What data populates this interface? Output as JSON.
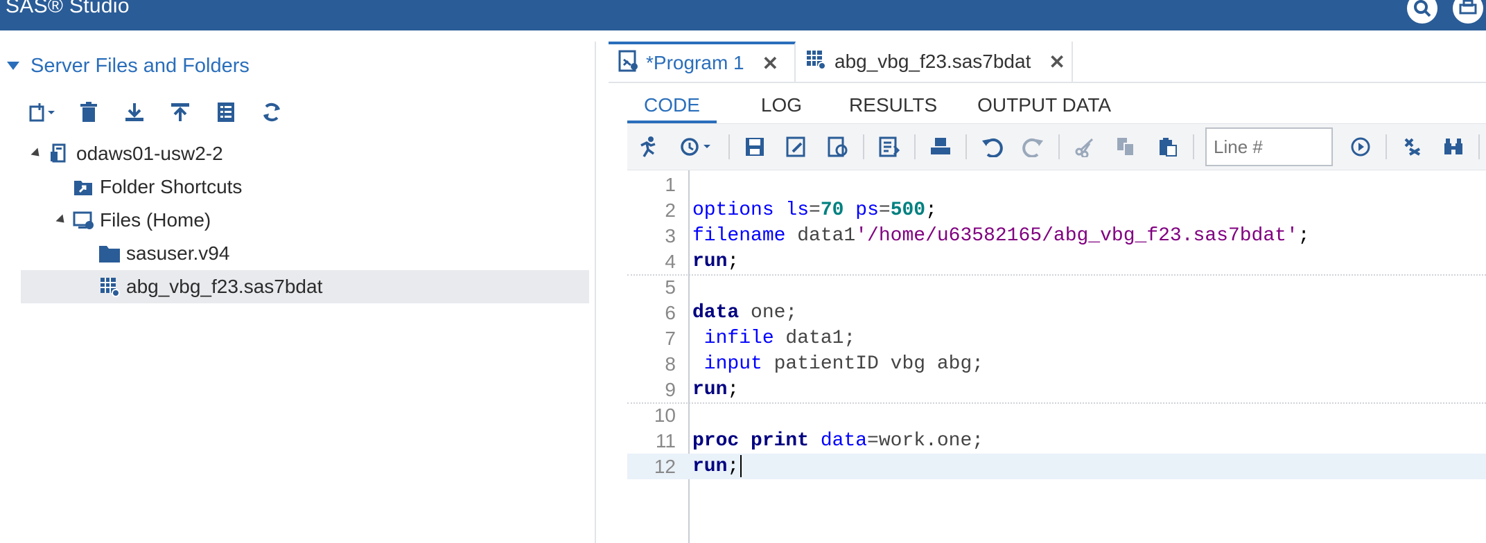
{
  "app": {
    "title": "SAS® Studio"
  },
  "left_panel": {
    "title": "Server Files and Folders",
    "tree": [
      {
        "label": "odaws01-usw2-2"
      },
      {
        "label": "Folder Shortcuts"
      },
      {
        "label": "Files (Home)"
      },
      {
        "label": "sasuser.v94"
      },
      {
        "label": "abg_vbg_f23.sas7bdat"
      }
    ]
  },
  "tabs": [
    {
      "label": "*Program 1"
    },
    {
      "label": "abg_vbg_f23.sas7bdat"
    }
  ],
  "subtabs": [
    "CODE",
    "LOG",
    "RESULTS",
    "OUTPUT DATA"
  ],
  "toolbar": {
    "line_placeholder": "Line #"
  },
  "editor": {
    "line_numbers": [
      "1",
      "2",
      "3",
      "4",
      "5",
      "6",
      "7",
      "8",
      "9",
      "10",
      "11",
      "12"
    ],
    "code": {
      "l2_a": "options",
      "l2_b": " ls",
      "l2_c": "=",
      "l2_d": "70",
      "l2_e": " ps",
      "l2_f": "=",
      "l2_g": "500",
      "l2_h": ";",
      "l3_a": "filename",
      "l3_b": " data1",
      "l3_c": "'/home/u63582165/abg_vbg_f23.sas7bdat'",
      "l3_d": ";",
      "l4_a": "run",
      "l4_b": ";",
      "l6_a": "data",
      "l6_b": " one;",
      "l7_a": " infile",
      "l7_b": " data1;",
      "l8_a": " input",
      "l8_b": " patientID vbg abg;",
      "l9_a": "run",
      "l9_b": ";",
      "l11_a": "proc print",
      "l11_b": " data",
      "l11_c": "=work.one;",
      "l12_a": "run",
      "l12_b": ";"
    }
  },
  "colors": {
    "header": "#2a5c97",
    "accent": "#2a6ebb"
  }
}
